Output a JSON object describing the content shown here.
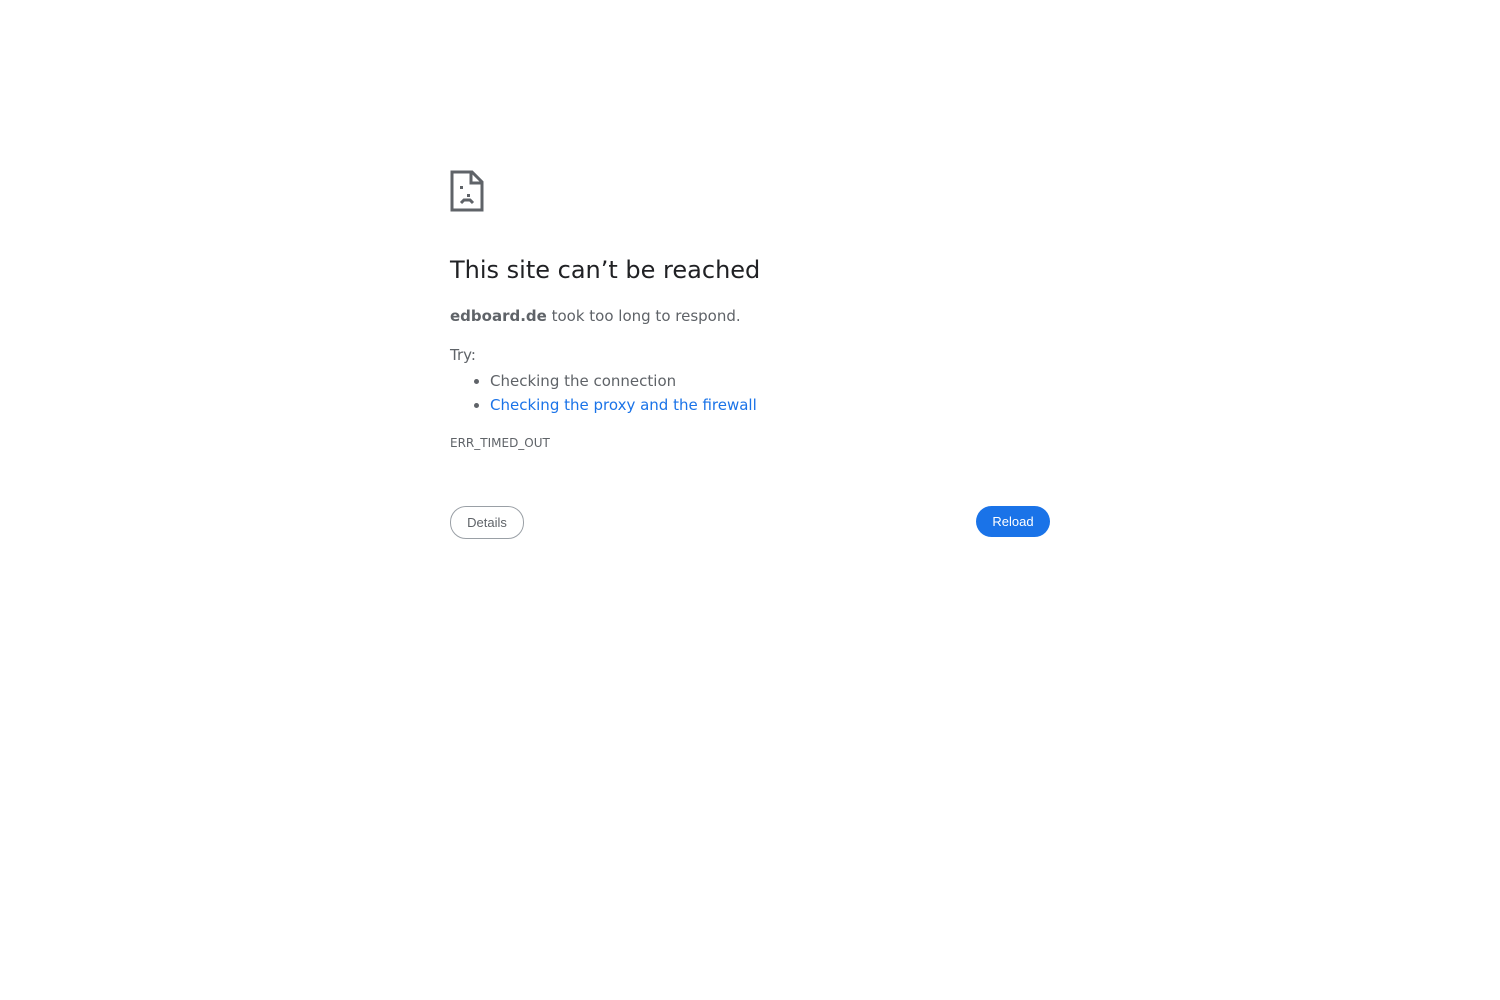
{
  "error_page": {
    "icon": "sad-document-icon",
    "title": "This site can’t be reached",
    "host": "edboard.de",
    "message_suffix": " took too long to respond.",
    "try_label": "Try:",
    "suggestions": [
      {
        "label": "Checking the connection"
      },
      {
        "label": "Checking the proxy and the firewall"
      }
    ],
    "error_code": "ERR_TIMED_OUT",
    "buttons": {
      "details_label": "Details",
      "reload_label": "Reload"
    }
  },
  "colors": {
    "title": "#202124",
    "text": "#5f6368",
    "link": "#1a73e8",
    "primary_button": "#1a73e8"
  }
}
